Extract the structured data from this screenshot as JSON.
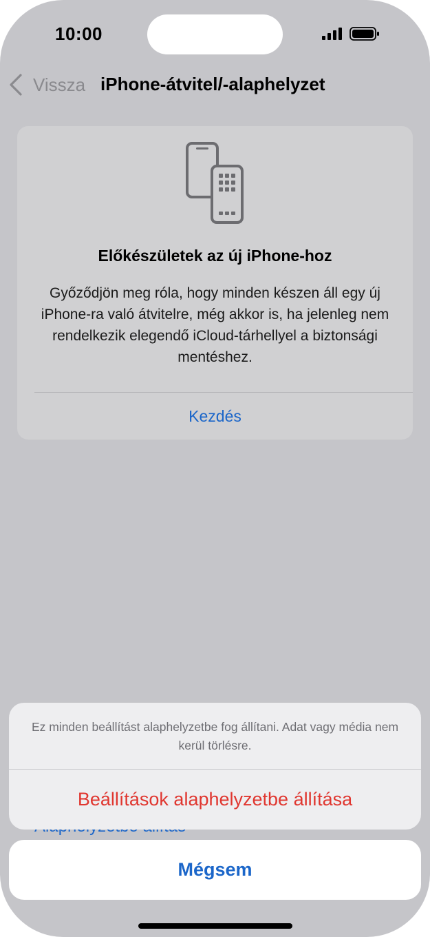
{
  "status_bar": {
    "time": "10:00"
  },
  "nav": {
    "back_label": "Vissza",
    "title": "iPhone-átvitel/-alaphelyzet"
  },
  "card": {
    "icon": "phone-transfer-icon",
    "title": "Előkészületek az új iPhone-hoz",
    "body": "Győződjön meg róla, hogy minden készen áll egy új iPhone-ra való átvitelre, még akkor is, ha jelenleg nem rendelkezik elegendő iCloud-tárhellyel a biztonsági mentéshez.",
    "link_label": "Kezdés"
  },
  "background_row": {
    "label": "Alaphelyzetbe állítás"
  },
  "action_sheet": {
    "message": "Ez minden beállítást alaphelyzetbe fog állítani. Adat vagy média nem kerül törlésre.",
    "destructive_label": "Beállítások alaphelyzetbe állítása",
    "cancel_label": "Mégsem"
  },
  "colors": {
    "link_blue": "#1b66c9",
    "destructive_red": "#e0362f",
    "dimmed_background": "#c5c5c9"
  }
}
